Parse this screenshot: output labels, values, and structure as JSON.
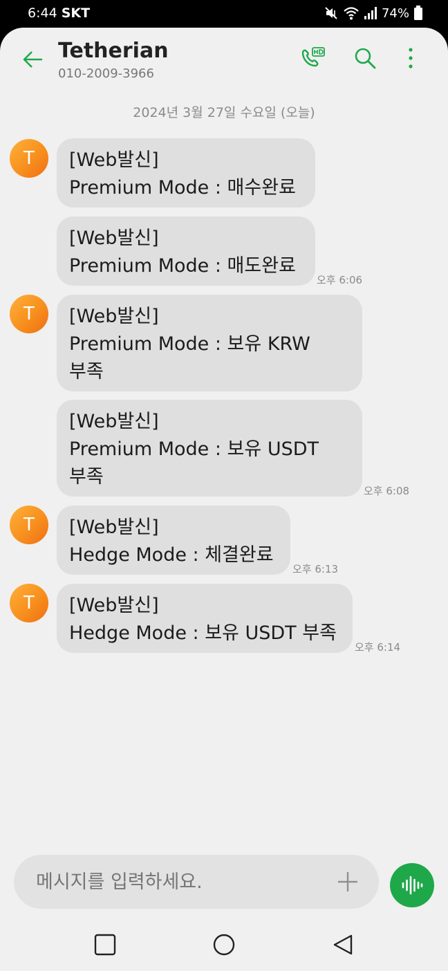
{
  "status_bar": {
    "time": "6:44",
    "carrier": "SKT",
    "battery": "74%",
    "icons": [
      "mute-icon",
      "wifi-icon",
      "signal-icon",
      "battery-icon"
    ]
  },
  "header": {
    "contact_name": "Tetherian",
    "phone_number": "010-2009-3966",
    "actions": [
      "back-arrow-icon",
      "hd-call-icon",
      "search-icon",
      "more-vert-icon"
    ]
  },
  "conversation": {
    "date_separator": "2024년 3월 27일 수요일 (오늘)",
    "avatar_letter": "T",
    "messages": [
      {
        "text": "[Web발신]\nPremium Mode : 매수완료",
        "time": ""
      },
      {
        "text": "[Web발신]\nPremium Mode : 매도완료",
        "time": "오후 6:06"
      },
      {
        "text": "[Web발신]\nPremium Mode : 보유 KRW\n부족",
        "time": ""
      },
      {
        "text": "[Web발신]\nPremium Mode : 보유 USDT\n부족",
        "time": "오후 6:08"
      },
      {
        "text": "[Web발신]\nHedge Mode : 체결완료",
        "time": "오후 6:13"
      },
      {
        "text": "[Web발신]\nHedge Mode : 보유 USDT 부족",
        "time": "오후 6:14"
      }
    ]
  },
  "composer": {
    "placeholder": "메시지를 입력하세요.",
    "add_icon": "plus-icon",
    "voice_icon": "voice-wave-icon"
  },
  "colors": {
    "accent": "#1ea84a",
    "bubble": "#dfdfdf",
    "background": "#f0f0f0",
    "avatar": "#f7901e"
  }
}
